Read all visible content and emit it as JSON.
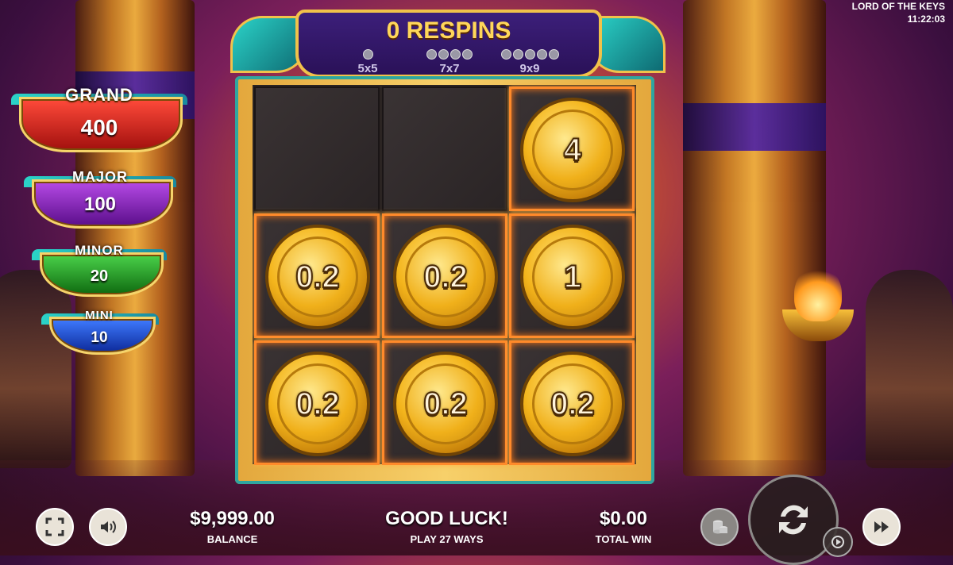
{
  "game": {
    "title": "LORD OF THE KEYS",
    "clock": "11:22:03"
  },
  "jackpots": [
    {
      "name": "GRAND",
      "value": "400",
      "color": "#d8221e"
    },
    {
      "name": "MAJOR",
      "value": "100",
      "color": "#8a24c2"
    },
    {
      "name": "MINOR",
      "value": "20",
      "color": "#21a521"
    },
    {
      "name": "MINI",
      "value": "10",
      "color": "#1b4ad0"
    }
  ],
  "header": {
    "respins": "0 RESPINS",
    "grids": [
      "5x5",
      "7x7",
      "9x9"
    ]
  },
  "board": {
    "rows": [
      [
        "",
        "",
        "4"
      ],
      [
        "0.2",
        "0.2",
        "1"
      ],
      [
        "0.2",
        "0.2",
        "0.2"
      ]
    ]
  },
  "bottom": {
    "balance_value": "$9,999.00",
    "balance_label": "BALANCE",
    "message": "GOOD LUCK!",
    "ways": "PLAY 27 WAYS",
    "win_value": "$0.00",
    "win_label": "TOTAL WIN"
  },
  "icons": [
    "fullscreen-icon",
    "sound-icon",
    "coins-stack-icon",
    "spin-icon",
    "autoplay-icon",
    "fast-forward-icon"
  ]
}
